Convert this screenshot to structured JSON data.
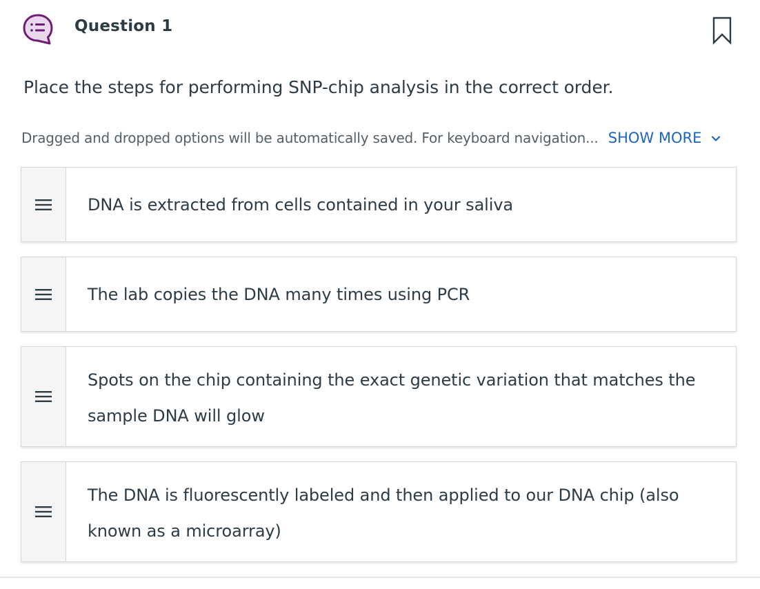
{
  "question": {
    "icon": "chat-list-icon",
    "title": "Question 1",
    "bookmark_icon": "bookmark-icon",
    "prompt": "Place the steps for performing SNP-chip analysis in the correct order.",
    "helper_text": "Dragged and dropped options will be automatically saved. For keyboard navigation...",
    "show_more_label": "SHOW MORE",
    "show_more_icon": "chevron-down-icon"
  },
  "items": [
    {
      "text": "DNA is extracted from cells contained in your saliva",
      "handle_icon": "drag-handle-icon"
    },
    {
      "text": "The lab copies the DNA many times using PCR",
      "handle_icon": "drag-handle-icon"
    },
    {
      "text": "Spots on the chip containing the exact genetic variation that matches the sample DNA will glow",
      "handle_icon": "drag-handle-icon"
    },
    {
      "text": "The DNA is fluorescently labeled and then applied to our DNA chip (also known as a microarray)",
      "handle_icon": "drag-handle-icon"
    }
  ],
  "colors": {
    "icon_purple": "#6f1a73",
    "link_blue": "#1a63c7",
    "text": "#2d3b45",
    "border": "#d3d8dc"
  }
}
